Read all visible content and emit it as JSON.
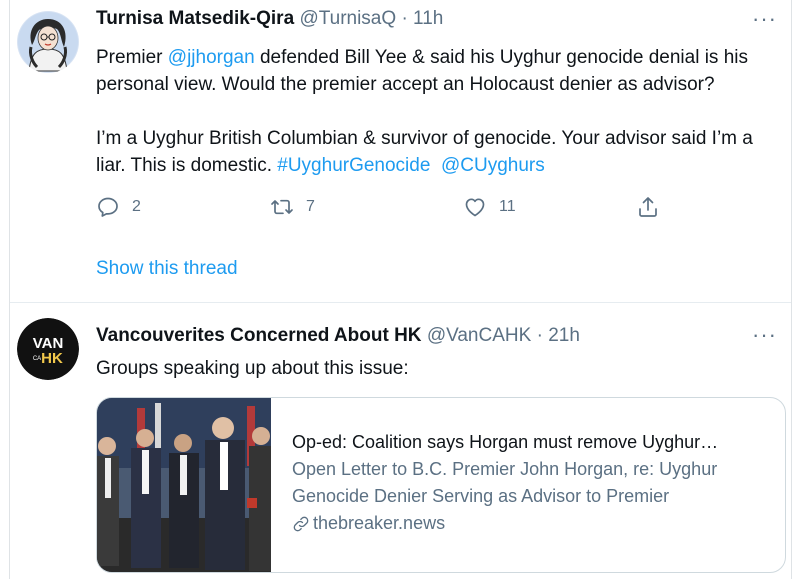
{
  "tweets": [
    {
      "name": "Turnisa Matsedik-Qira",
      "handle": "@TurnisaQ",
      "dot": "·",
      "time": "11h",
      "more": "···",
      "line1_pre": "Premier ",
      "line1_mention": "@jjhorgan",
      "line1_post": " defended Bill Yee & said his Uyghur genocide denial is his personal view. Would the premier accept an Holocaust denier as advisor?",
      "para2": "I’m a Uyghur British Columbian & survivor of genocide. Your advisor said I’m a liar. This is domestic. ",
      "hashtag": "#UyghurGenocide",
      "mention2": "@CUyghurs",
      "replies": "2",
      "retweets": "7",
      "likes": "11",
      "show_thread": "Show this thread"
    },
    {
      "name": "Vancouverites Concerned About HK",
      "handle": "@VanCAHK",
      "dot": "·",
      "time": "21h",
      "more": "···",
      "text": "Groups speaking up about this issue:",
      "avatar_text_1": "VAN",
      "avatar_text_2": "HK",
      "avatar_text_small": "CA",
      "card": {
        "title": "Op-ed: Coalition says Horgan must remove Uyghur…",
        "description": "Open Letter to B.C. Premier John Horgan, re: Uyghur Genocide Denier Serving as Advisor to Premier",
        "domain": "thebreaker.news"
      }
    }
  ],
  "colors": {
    "link": "#1d9bf0",
    "secondary_text": "#5b7083",
    "border": "#cfd9de"
  },
  "icons": [
    "reply-icon",
    "retweet-icon",
    "like-icon",
    "share-icon",
    "link-icon",
    "more-icon"
  ]
}
